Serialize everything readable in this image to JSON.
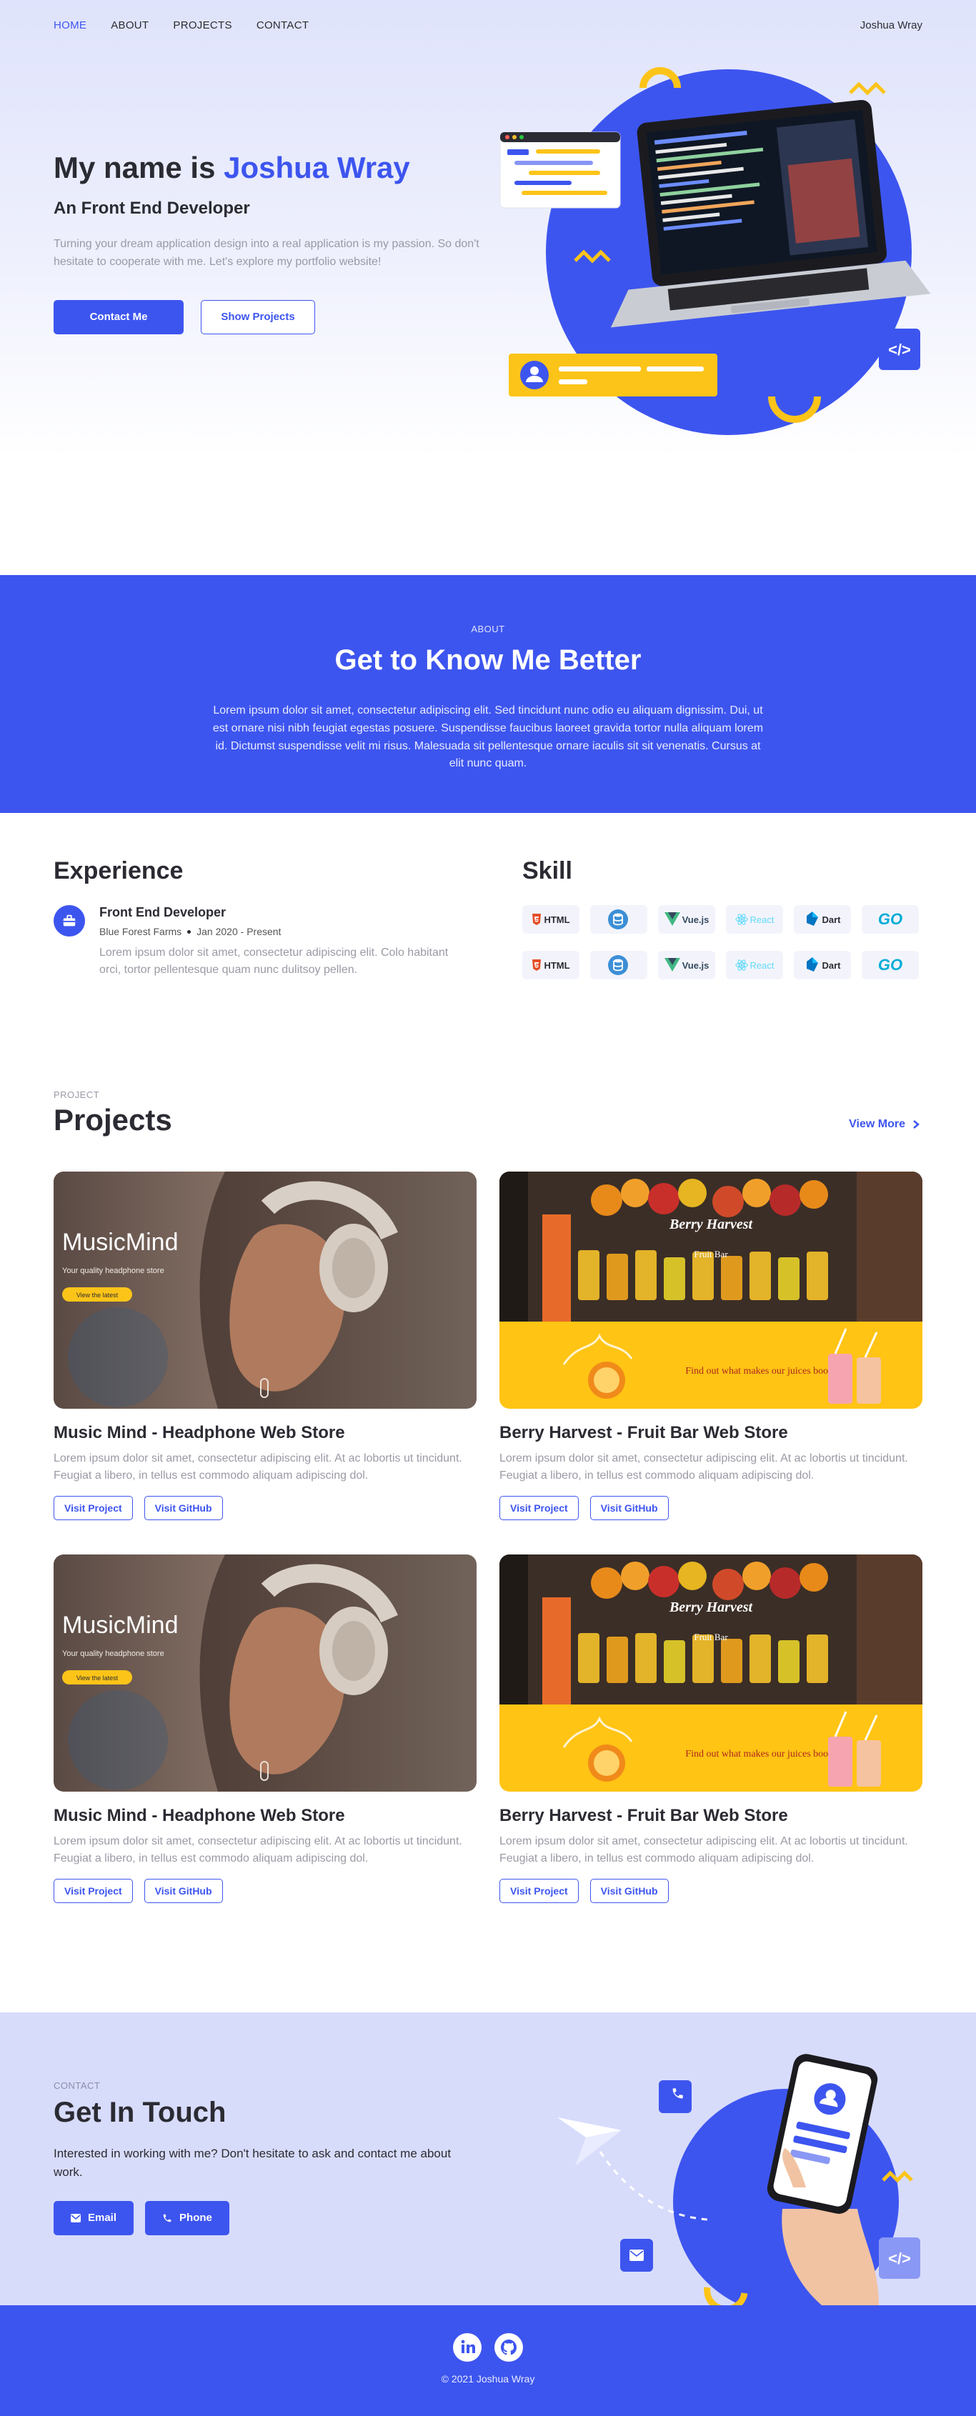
{
  "nav": {
    "links": [
      "HOME",
      "ABOUT",
      "PROJECTS",
      "CONTACT"
    ],
    "brand": "Joshua Wray"
  },
  "hero": {
    "title_prefix": "My name is ",
    "title_name": "Joshua Wray",
    "subtitle": "An Front End Developer",
    "description": "Turning your dream application design into a real application is my passion. So don't hesitate to cooperate with me. Let's explore my portfolio website!",
    "primary_button": "Contact Me",
    "secondary_button": "Show Projects"
  },
  "about": {
    "kicker": "ABOUT",
    "title": "Get to Know Me Better",
    "text": "Lorem ipsum dolor sit amet, consectetur adipiscing elit. Sed tincidunt nunc odio eu aliquam dignissim. Dui, ut est ornare nisi nibh feugiat egestas posuere. Suspendisse faucibus laoreet gravida tortor nulla aliquam lorem id. Dictumst suspendisse velit mi risus. Malesuada sit pellentesque ornare iaculis sit sit venenatis. Cursus at elit nunc quam."
  },
  "experience": {
    "title": "Experience",
    "role": "Front End Developer",
    "company": "Blue Forest Farms",
    "period": "Jan 2020 - Present",
    "description": "Lorem ipsum dolor sit amet, consectetur adipiscing elit. Colo habitant orci, tortor pellentesque quam nunc dulitsoy pellen."
  },
  "skill": {
    "title": "Skill",
    "items": [
      {
        "label": "HTML",
        "icon": "html5-icon"
      },
      {
        "label": "",
        "icon": "database-icon"
      },
      {
        "label": "Vue.js",
        "icon": "vue-icon"
      },
      {
        "label": "React",
        "icon": "react-icon"
      },
      {
        "label": "Dart",
        "icon": "dart-icon"
      },
      {
        "label": "GO",
        "icon": "go-icon"
      },
      {
        "label": "HTML",
        "icon": "html5-icon"
      },
      {
        "label": "",
        "icon": "database-icon"
      },
      {
        "label": "Vue.js",
        "icon": "vue-icon"
      },
      {
        "label": "React",
        "icon": "react-icon"
      },
      {
        "label": "Dart",
        "icon": "dart-icon"
      },
      {
        "label": "GO",
        "icon": "go-icon"
      }
    ]
  },
  "projects": {
    "kicker": "PROJECT",
    "title": "Projects",
    "view_more": "View More",
    "items": [
      {
        "title": "Music Mind - Headphone Web Store",
        "description": "Lorem ipsum dolor sit amet, consectetur adipiscing elit. At ac lobortis ut tincidunt. Feugiat a libero, in tellus est commodo aliquam adipiscing dol.",
        "visit": "Visit Project",
        "github": "Visit GitHub",
        "thumb": {
          "brand": "MusicMind",
          "tagline": "Your quality headphone store",
          "cta": "View the latest"
        }
      },
      {
        "title": "Berry Harvest - Fruit Bar Web Store",
        "description": "Lorem ipsum dolor sit amet, consectetur adipiscing elit. At ac lobortis ut tincidunt. Feugiat a libero, in tellus est commodo aliquam adipiscing dol.",
        "visit": "Visit Project",
        "github": "Visit GitHub",
        "thumb": {
          "brand": "Berry Harvest",
          "tagline": "Fruit Bar",
          "banner": "Find out what makes our juices boom!"
        }
      },
      {
        "title": "Music Mind - Headphone Web Store",
        "description": "Lorem ipsum dolor sit amet, consectetur adipiscing elit. At ac lobortis ut tincidunt. Feugiat a libero, in tellus est commodo aliquam adipiscing dol.",
        "visit": "Visit Project",
        "github": "Visit GitHub",
        "thumb": {
          "brand": "MusicMind",
          "tagline": "Your quality headphone store",
          "cta": "View the latest"
        }
      },
      {
        "title": "Berry Harvest - Fruit Bar Web Store",
        "description": "Lorem ipsum dolor sit amet, consectetur adipiscing elit. At ac lobortis ut tincidunt. Feugiat a libero, in tellus est commodo aliquam adipiscing dol.",
        "visit": "Visit Project",
        "github": "Visit GitHub",
        "thumb": {
          "brand": "Berry Harvest",
          "tagline": "Fruit Bar",
          "banner": "Find out what makes our juices boom!"
        }
      }
    ]
  },
  "contact": {
    "kicker": "CONTACT",
    "title": "Get In Touch",
    "text": "Interested in working with me? Don't hesitate to ask and contact me about work.",
    "email_button": "Email",
    "phone_button": "Phone"
  },
  "footer": {
    "copyright": "© 2021 Joshua Wray",
    "social": [
      "linkedin-icon",
      "github-icon"
    ]
  },
  "colors": {
    "accent": "#3d55ef",
    "yellow": "#fcc419",
    "text": "#2b2b33",
    "muted": "#9a9aa6"
  }
}
